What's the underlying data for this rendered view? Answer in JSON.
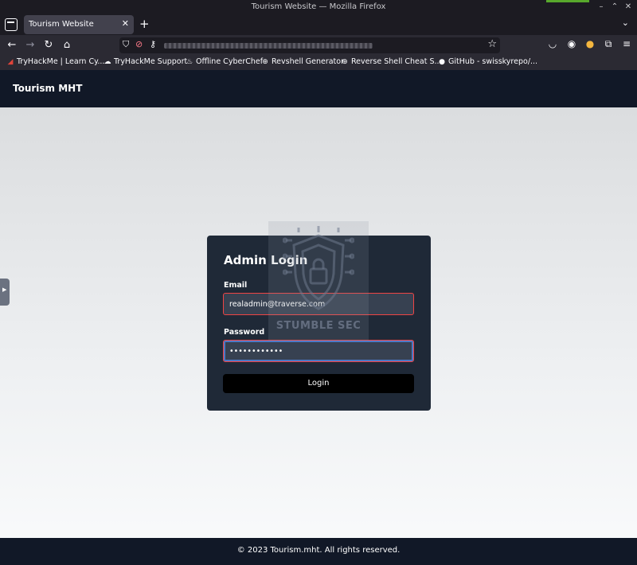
{
  "browser": {
    "window_title": "Tourism Website — Mozilla Firefox",
    "tab_title": "Tourism Website",
    "bookmarks": [
      {
        "label": "TryHackMe | Learn Cy...",
        "icon": "thm-icon"
      },
      {
        "label": "TryHackMe Support",
        "icon": "cloud-icon"
      },
      {
        "label": "Offline CyberChef",
        "icon": "chef-icon"
      },
      {
        "label": "Revshell Generator",
        "icon": "globe-icon"
      },
      {
        "label": "Reverse Shell Cheat S...",
        "icon": "globe-icon"
      },
      {
        "label": "GitHub - swisskyrepo/...",
        "icon": "github-icon"
      }
    ]
  },
  "site": {
    "brand": "Tourism MHT",
    "footer": "© 2023 Tourism.mht. All rights reserved."
  },
  "login": {
    "title": "Admin Login",
    "email_label": "Email",
    "email_value": "realadmin@traverse.com",
    "password_label": "Password",
    "password_value": "••••••••••••",
    "button_label": "Login"
  },
  "watermark": {
    "text": "STUMBLE SEC"
  },
  "colors": {
    "header_bg": "#111827",
    "card_bg": "#1f2937",
    "input_bg": "#374151",
    "error_border": "#ef4444"
  }
}
